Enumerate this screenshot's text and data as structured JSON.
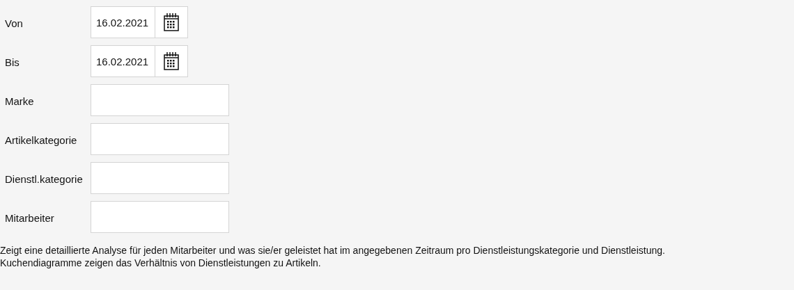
{
  "fields": [
    {
      "label": "Von",
      "kind": "date",
      "value": "16.02.2021"
    },
    {
      "label": "Bis",
      "kind": "date",
      "value": "16.02.2021"
    },
    {
      "label": "Marke",
      "kind": "text"
    },
    {
      "label": "Artikelkategorie",
      "kind": "text"
    },
    {
      "label": "Dienstl.kategorie",
      "kind": "text"
    },
    {
      "label": "Mitarbeiter",
      "kind": "text"
    }
  ],
  "description": [
    "Zeigt eine detaillierte Analyse für jeden Mitarbeiter und was sie/er geleistet hat im angegebenen Zeitraum pro Dienstleistungskategorie und Dienstleistung.",
    "Kuchendiagramme zeigen das Verhältnis von Dienstleistungen zu Artikeln."
  ]
}
